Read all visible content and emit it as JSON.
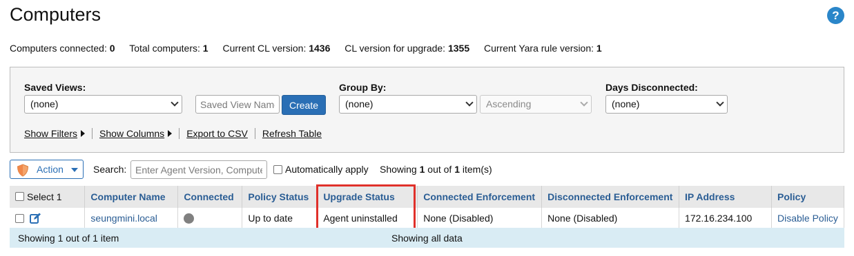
{
  "page": {
    "title": "Computers",
    "help_label": "?"
  },
  "stats": [
    {
      "label": "Computers connected:",
      "value": "0"
    },
    {
      "label": "Total computers:",
      "value": "1"
    },
    {
      "label": "Current CL version:",
      "value": "1436"
    },
    {
      "label": "CL version for upgrade:",
      "value": "1355"
    },
    {
      "label": "Current Yara rule version:",
      "value": "1"
    }
  ],
  "filters": {
    "saved_views_label": "Saved Views:",
    "saved_views_value": "(none)",
    "saved_view_name_placeholder": "Saved View Name",
    "create_label": "Create",
    "group_by_label": "Group By:",
    "group_by_value": "(none)",
    "sort_value": "Ascending",
    "days_disconnected_label": "Days Disconnected:",
    "days_disconnected_value": "(none)",
    "links": {
      "show_filters": "Show Filters",
      "show_columns": "Show Columns",
      "export_csv": "Export to CSV",
      "refresh_table": "Refresh Table"
    }
  },
  "toolbar": {
    "action_label": "Action",
    "search_label": "Search:",
    "search_placeholder": "Enter Agent Version, Computer",
    "auto_apply_label": "Automatically apply",
    "showing_prefix": "Showing ",
    "showing_count": "1",
    "showing_mid": " out of ",
    "showing_total": "1",
    "showing_suffix": " item(s)"
  },
  "table": {
    "headers": {
      "select": "Select 1",
      "computer_name": "Computer Name",
      "connected": "Connected",
      "policy_status": "Policy Status",
      "upgrade_status": "Upgrade Status",
      "connected_enforcement": "Connected Enforcement",
      "disconnected_enforcement": "Disconnected Enforcement",
      "ip_address": "IP Address",
      "policy": "Policy"
    },
    "rows": [
      {
        "computer_name": "seungmini.local",
        "connected_status": "gray",
        "policy_status": "Up to date",
        "upgrade_status": "Agent uninstalled",
        "connected_enforcement": "None (Disabled)",
        "disconnected_enforcement": "None (Disabled)",
        "ip_address": "172.16.234.100",
        "policy": "Disable Policy"
      }
    ]
  },
  "footer": {
    "left": "Showing 1 out of 1 item",
    "center": "Showing all data"
  },
  "colors": {
    "accent": "#2a6fb5",
    "link": "#2a5d94",
    "highlight": "#e0302a",
    "footer_bg": "#d9ecf4"
  }
}
